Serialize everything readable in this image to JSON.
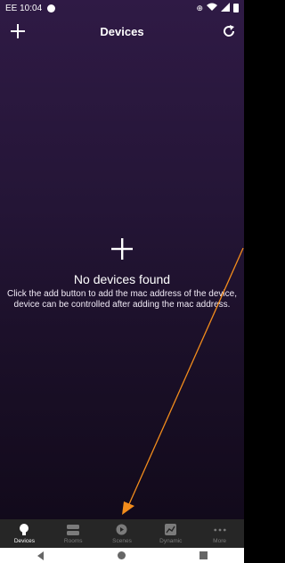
{
  "status": {
    "time": "EE 10:04"
  },
  "appbar": {
    "title": "Devices"
  },
  "empty": {
    "title": "No devices found",
    "description": "Click the add button to add the mac address of the device, device can be controlled after adding the mac address."
  },
  "tabs": [
    {
      "label": "Devices",
      "icon": "lightbulb-icon",
      "active": true
    },
    {
      "label": "Rooms",
      "icon": "rooms-icon",
      "active": false
    },
    {
      "label": "Scenes",
      "icon": "play-circle-icon",
      "active": false
    },
    {
      "label": "Dynamic",
      "icon": "dynamic-chart-icon",
      "active": false
    },
    {
      "label": "More",
      "icon": "more-dots-icon",
      "active": false
    }
  ],
  "colors": {
    "background_top": "#2f1a45",
    "background_bottom": "#120a1b",
    "annotation_arrow": "#f28c1c",
    "tabbar": "#262626"
  }
}
